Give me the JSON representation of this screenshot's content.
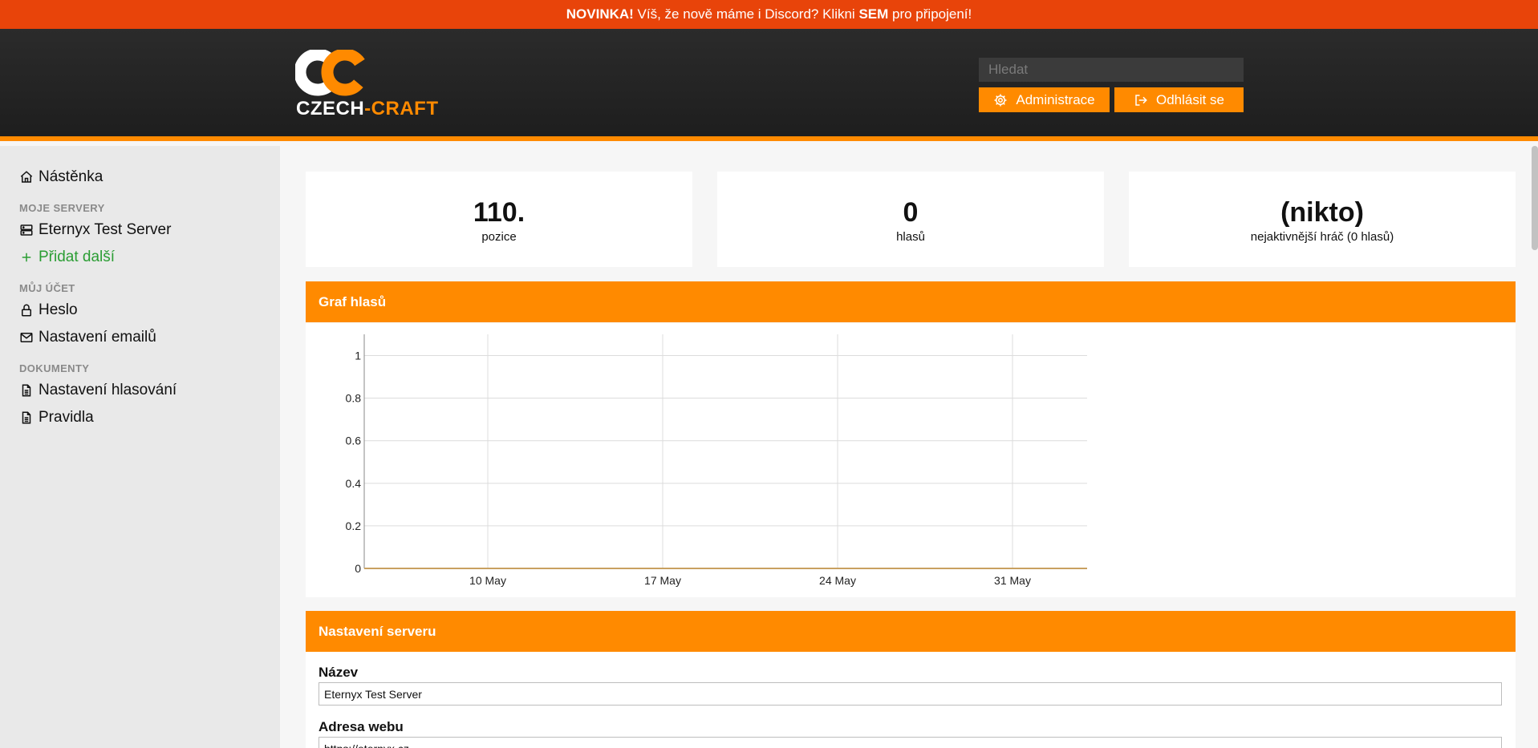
{
  "announcement": {
    "lead": "NOVINKA!",
    "text": " Víš, že nově máme i Discord? Klikni ",
    "link": "SEM",
    "tail": " pro připojení!"
  },
  "logo": {
    "word1": "CZECH",
    "dash": "-",
    "word2": "CRAFT"
  },
  "search": {
    "placeholder": "Hledat"
  },
  "header_buttons": {
    "admin": "Administrace",
    "logout": "Odhlásit se"
  },
  "sidebar": {
    "dashboard": "Nástěnka",
    "my_servers_heading": "MOJE SERVERY",
    "server": "Eternyx Test Server",
    "add_more": "Přidat další",
    "account_heading": "MŮJ ÚČET",
    "password": "Heslo",
    "email_settings": "Nastavení emailů",
    "documents_heading": "DOKUMENTY",
    "vote_settings": "Nastavení hlasování",
    "rules": "Pravidla"
  },
  "stats": [
    {
      "value": "110.",
      "label": "pozice"
    },
    {
      "value": "0",
      "label": "hlasů"
    },
    {
      "value": "(nikto)",
      "label": "nejaktivnější hráč (0 hlasů)"
    }
  ],
  "vote_chart_panel": {
    "title": "Graf hlasů"
  },
  "chart_data": {
    "type": "line",
    "title": "",
    "xlabel": "",
    "ylabel": "",
    "x_ticks": [
      "10 May",
      "17 May",
      "24 May",
      "31 May"
    ],
    "y_ticks": [
      "0",
      "0.2",
      "0.4",
      "0.6",
      "0.8",
      "1"
    ],
    "ylim": [
      0,
      1.1
    ],
    "series": [
      {
        "values": [
          0,
          0,
          0,
          0
        ],
        "color": "#c8a060"
      }
    ],
    "grid": true
  },
  "server_settings": {
    "title": "Nastavení serveru",
    "name_label": "Název",
    "name_value": "Eternyx Test Server",
    "web_label": "Adresa webu",
    "web_value": "https://eternyx.cz"
  },
  "colors": {
    "accent": "#ff8a00",
    "announcement": "#e8440a",
    "header": "#222222",
    "add": "#2a9d33"
  }
}
